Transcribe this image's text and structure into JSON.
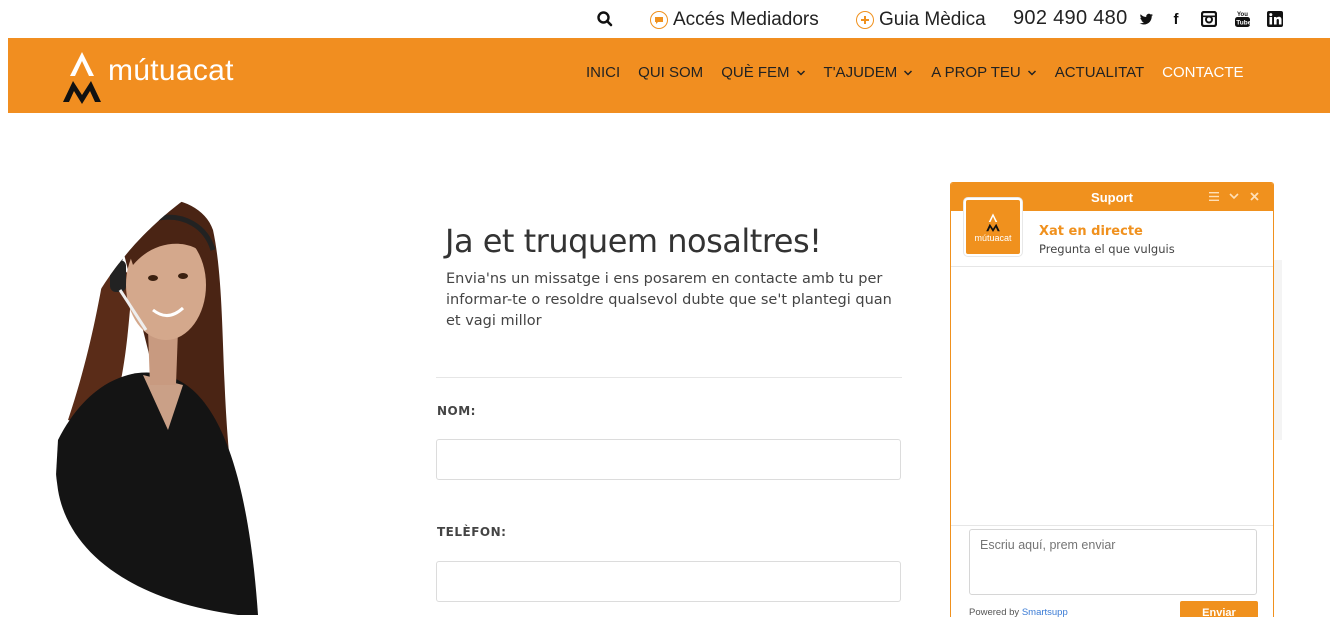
{
  "topbar": {
    "mediadors_label": "Accés Mediadors",
    "guia_label": "Guia Mèdica",
    "phone": "902 490 480",
    "icons": [
      "search-icon",
      "chat-bubble-icon",
      "plus-circle-icon",
      "twitter-icon",
      "facebook-icon",
      "instagram-icon",
      "youtube-icon",
      "linkedin-icon"
    ]
  },
  "header": {
    "brand": "mútuacat",
    "nav": [
      {
        "label": "INICI",
        "dropdown": false
      },
      {
        "label": "QUI SOM",
        "dropdown": false
      },
      {
        "label": "QUÈ FEM",
        "dropdown": true
      },
      {
        "label": "T'AJUDEM",
        "dropdown": true
      },
      {
        "label": "A PROP TEU",
        "dropdown": true
      },
      {
        "label": "ACTUALITAT",
        "dropdown": false
      },
      {
        "label": "CONTACTE",
        "dropdown": false,
        "active": true
      }
    ]
  },
  "main": {
    "title": "Ja et truquem nosaltres!",
    "intro": "Envia'ns un missatge i ens posarem en contacte amb tu per informar-te o resoldre qualsevol dubte que se't plantegi quan et vagi millor",
    "fields": [
      {
        "label": "NOM:",
        "value": ""
      },
      {
        "label": "TELÈFON:",
        "value": ""
      }
    ]
  },
  "chat": {
    "header_title": "Suport",
    "agent_name": "Xat en directe",
    "agent_subtitle": "Pregunta el que vulguis",
    "avatar_text": "mútuacat",
    "input_placeholder": "Escriu aquí, prem enviar",
    "powered_by": "Powered by",
    "powered_link": "Smartsupp",
    "send_label": "Enviar"
  },
  "colors": {
    "brand_orange": "#f18e20",
    "text_dark": "#222222",
    "link_blue": "#3a7bd5"
  }
}
